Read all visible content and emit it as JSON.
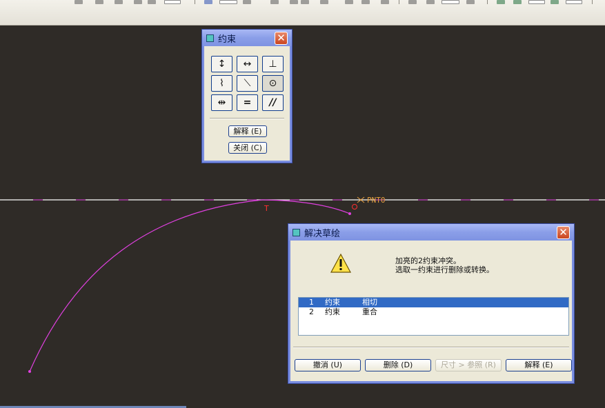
{
  "constraint_dialog": {
    "title": "约束",
    "close_glyph": "✕",
    "buttons": [
      {
        "name": "vertical",
        "glyph": "↕"
      },
      {
        "name": "horizontal",
        "glyph": "↔"
      },
      {
        "name": "perpendicular",
        "glyph": "⊥"
      },
      {
        "name": "tangent",
        "glyph": "⌇"
      },
      {
        "name": "point-on-line",
        "glyph": "⟍"
      },
      {
        "name": "coincident",
        "glyph": "⊙"
      },
      {
        "name": "symmetric",
        "glyph": "⇹"
      },
      {
        "name": "equal",
        "glyph": "="
      },
      {
        "name": "parallel",
        "glyph": "//"
      }
    ],
    "explain_label": "解释 (E)",
    "close_label": "关闭 (C)"
  },
  "sketch": {
    "point_label": "PNT0",
    "tangent_marker": "T",
    "line_color": "#e040e0",
    "center_line_color": "#ffffff"
  },
  "resolve_dialog": {
    "title": "解决草绘",
    "close_glyph": "✕",
    "warning_icon": "warning-icon",
    "message_line1": "加亮的2约束冲突。",
    "message_line2": "选取一约束进行删除或转换。",
    "rows": [
      {
        "index": "1",
        "type": "约束",
        "desc": "相切",
        "selected": true
      },
      {
        "index": "2",
        "type": "约束",
        "desc": "重合",
        "selected": false
      }
    ],
    "undo_label": "撤消 (U)",
    "delete_label": "删除 (D)",
    "dim_to_ref_label": "尺寸 > 参照 (R)",
    "explain_label": "解释 (E)"
  }
}
